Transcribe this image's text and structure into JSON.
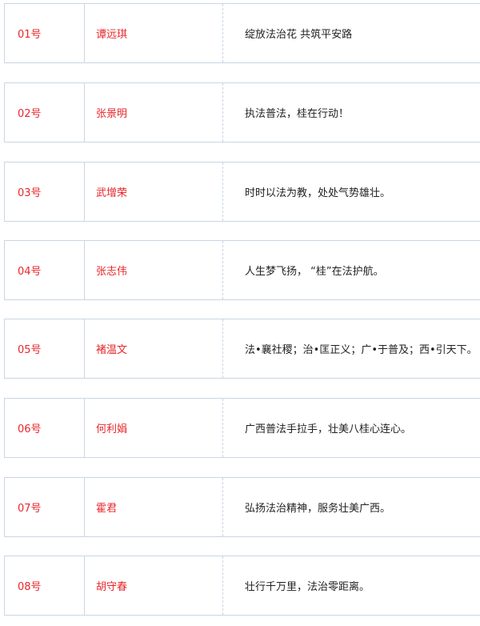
{
  "rows": [
    {
      "no": "01号",
      "name": "谭远琪",
      "slogan": "绽放法治花 共筑平安路"
    },
    {
      "no": "02号",
      "name": "张景明",
      "slogan": "执法普法，桂在行动！"
    },
    {
      "no": "03号",
      "name": "武增荣",
      "slogan": "时时以法为教，处处气势雄壮。"
    },
    {
      "no": "04号",
      "name": "张志伟",
      "slogan": "人生梦飞扬， “桂”在法护航。"
    },
    {
      "no": "05号",
      "name": "褚温文",
      "slogan": "法•襄社稷；治•匡正义；广•于普及；西•引天下。"
    },
    {
      "no": "06号",
      "name": "何利娟",
      "slogan": "广西普法手拉手，壮美八桂心连心。"
    },
    {
      "no": "07号",
      "name": "霍君",
      "slogan": "弘扬法治精神，服务壮美广西。"
    },
    {
      "no": "08号",
      "name": "胡守春",
      "slogan": "壮行千万里，法治零距离。"
    }
  ],
  "colors": {
    "accent_red": "#e8262a",
    "border": "#c9d6e3"
  }
}
